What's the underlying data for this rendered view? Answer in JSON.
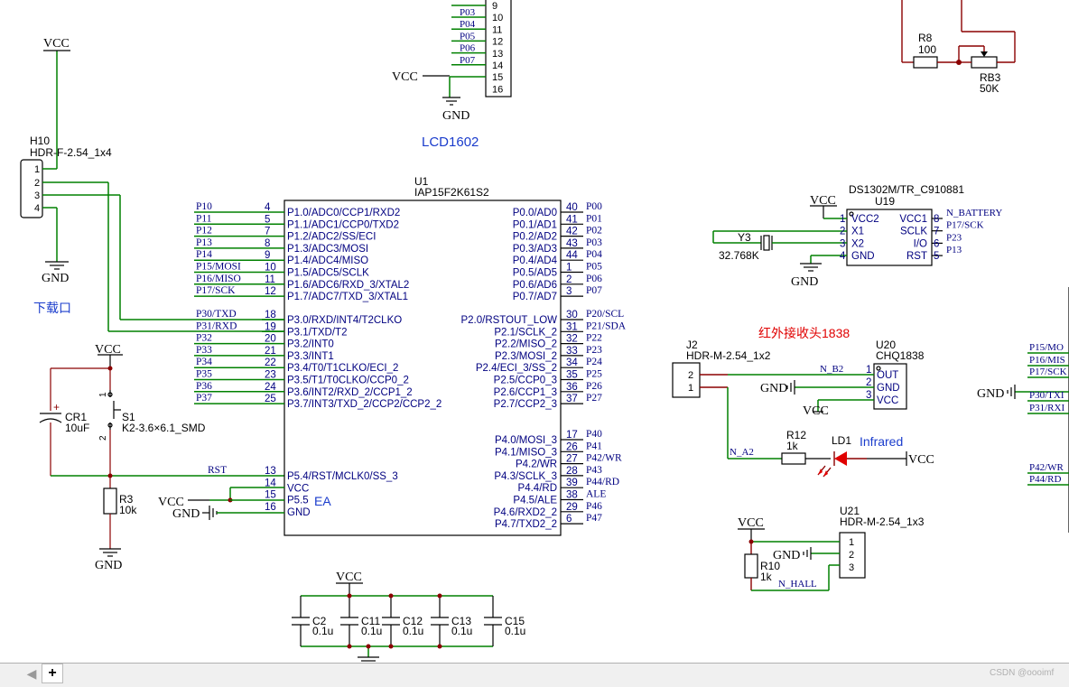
{
  "title": "LCD1602",
  "net": {
    "vcc": "VCC",
    "gnd": "GND"
  },
  "u1": {
    "ref": "U1",
    "part": "IAP15F2K61S2",
    "left": [
      [
        "P10",
        "4",
        "P1.0/ADC0/CCP1/RXD2"
      ],
      [
        "P11",
        "5",
        "P1.1/ADC1/CCP0/TXD2"
      ],
      [
        "P12",
        "7",
        "P1.2/ADC2/SS/ECI"
      ],
      [
        "P13",
        "8",
        "P1.3/ADC3/MOSI"
      ],
      [
        "P14",
        "9",
        "P1.4/ADC4/MISO"
      ],
      [
        "P15/MOSI",
        "10",
        "P1.5/ADC5/SCLK"
      ],
      [
        "P16/MISO",
        "11",
        "P1.6/ADC6/RXD_3/XTAL2"
      ],
      [
        "P17/SCK",
        "12",
        "P1.7/ADC7/TXD_3/XTAL1"
      ],
      [
        "P30/TXD",
        "18",
        "P3.0/RXD/INT4/T2CLKO"
      ],
      [
        "P31/RXD",
        "19",
        "P3.1/TXD/T2"
      ],
      [
        "P32",
        "20",
        "P3.2/INT0"
      ],
      [
        "P33",
        "21",
        "P3.3/INT1"
      ],
      [
        "P34",
        "22",
        "P3.4/T0/T1CLKO/ECI_2"
      ],
      [
        "P35",
        "23",
        "P3.5/T1/T0CLKO/CCP0_2"
      ],
      [
        "P36",
        "24",
        "P3.6/INT2/RXD_2/CCP1_2"
      ],
      [
        "P37",
        "25",
        "P3.7/INT3/TXD_2/CCP2/CCP2_2"
      ],
      [
        "RST",
        "13",
        "P5.4/RST/MCLK0/SS_3"
      ],
      [
        "",
        "14",
        "VCC"
      ],
      [
        "",
        "15",
        "P5.5"
      ],
      [
        "",
        "16",
        "GND"
      ]
    ],
    "right": [
      [
        "P00",
        "40",
        "P0.0/AD0"
      ],
      [
        "P01",
        "41",
        "P0.1/AD1"
      ],
      [
        "P02",
        "42",
        "P0.2/AD2"
      ],
      [
        "P03",
        "43",
        "P0.3/AD3"
      ],
      [
        "P04",
        "44",
        "P0.4/AD4"
      ],
      [
        "P05",
        "1",
        "P0.5/AD5"
      ],
      [
        "P06",
        "2",
        "P0.6/AD6"
      ],
      [
        "P07",
        "3",
        "P0.7/AD7"
      ],
      [
        "P20/SCL",
        "30",
        "P2.0/RSTOUT_LOW"
      ],
      [
        "P21/SDA",
        "31",
        "P2.1/SCLK_2"
      ],
      [
        "P22",
        "32",
        "P2.2/MISO_2"
      ],
      [
        "P23",
        "33",
        "P2.3/MOSI_2"
      ],
      [
        "P24",
        "34",
        "P2.4/ECI_3/SS_2"
      ],
      [
        "P25",
        "35",
        "P2.5/CCP0_3"
      ],
      [
        "P26",
        "36",
        "P2.6/CCP1_3"
      ],
      [
        "P27",
        "37",
        "P2.7/CCP2_3"
      ],
      [
        "P40",
        "17",
        "P4.0/MOSI_3"
      ],
      [
        "P41",
        "26",
        "P4.1/MISO_3"
      ],
      [
        "P42/WR",
        "27",
        "P4.2/WR"
      ],
      [
        "P43",
        "28",
        "P4.3/SCLK_3"
      ],
      [
        "P44/RD",
        "39",
        "P4.4/RD"
      ],
      [
        "ALE",
        "38",
        "P4.5/ALE"
      ],
      [
        "P46",
        "29",
        "P4.6/RXD2_2"
      ],
      [
        "P47",
        "6",
        "P4.7/TXD2_2"
      ]
    ],
    "ea": "EA"
  },
  "lcd": {
    "nets": [
      "P03",
      "P04",
      "P05",
      "P06",
      "P07"
    ],
    "pins": [
      "9",
      "10",
      "11",
      "12",
      "13",
      "14",
      "15",
      "16"
    ]
  },
  "h10": {
    "ref": "H10",
    "part": "HDR-F-2.54_1x4",
    "pins": [
      "1",
      "2",
      "3",
      "4"
    ],
    "label": "下载口"
  },
  "cr1": {
    "ref": "CR1",
    "val": "10uF"
  },
  "s1": {
    "ref": "S1",
    "part": "K2-3.6×6.1_SMD",
    "pins": [
      "1",
      "2"
    ]
  },
  "r3": {
    "ref": "R3",
    "val": "10k"
  },
  "caps": [
    {
      "ref": "C2",
      "val": "0.1u"
    },
    {
      "ref": "C11",
      "val": "0.1u"
    },
    {
      "ref": "C12",
      "val": "0.1u"
    },
    {
      "ref": "C13",
      "val": "0.1u"
    },
    {
      "ref": "C15",
      "val": "0.1u"
    }
  ],
  "r8": {
    "ref": "R8",
    "val": "100"
  },
  "rb3": {
    "ref": "RB3",
    "val": "50K"
  },
  "u19": {
    "ref": "U19",
    "part": "DS1302M/TR_C910881",
    "left": [
      [
        "1",
        "VCC2"
      ],
      [
        "2",
        "X1"
      ],
      [
        "3",
        "X2"
      ],
      [
        "4",
        "GND"
      ]
    ],
    "right": [
      [
        "8",
        "VCC1",
        "N_BATTERY"
      ],
      [
        "7",
        "SCLK",
        "P17/SCK"
      ],
      [
        "6",
        "I/O",
        "P23"
      ],
      [
        "5",
        "RST",
        "P13"
      ]
    ]
  },
  "y3": {
    "ref": "Y3",
    "val": "32.768K"
  },
  "ir": {
    "heading": "红外接收头1838",
    "ref": "U20",
    "part": "CHQ1838",
    "pins": [
      [
        "1",
        "OUT"
      ],
      [
        "2",
        "GND"
      ],
      [
        "3",
        "VCC"
      ]
    ],
    "net_b2": "N_B2",
    "net_a2": "N_A2"
  },
  "j2": {
    "ref": "J2",
    "part": "HDR-M-2.54_1x2",
    "pins": [
      "2",
      "1"
    ]
  },
  "r12": {
    "ref": "R12",
    "val": "1k"
  },
  "ld1": {
    "ref": "LD1",
    "label": "Infrared"
  },
  "u21": {
    "ref": "U21",
    "part": "HDR-M-2.54_1x3",
    "pins": [
      "1",
      "2",
      "3"
    ]
  },
  "r10": {
    "ref": "R10",
    "val": "1k",
    "net": "N_HALL"
  },
  "right_edge": [
    "P15/MO",
    "P16/MIS",
    "P17/SCK",
    "P30/TXI",
    "P31/RXI",
    "P42/WR",
    "P44/RD"
  ],
  "tabs": {
    "left": "◀",
    "add": "+"
  },
  "watermark": "CSDN @oooimf"
}
